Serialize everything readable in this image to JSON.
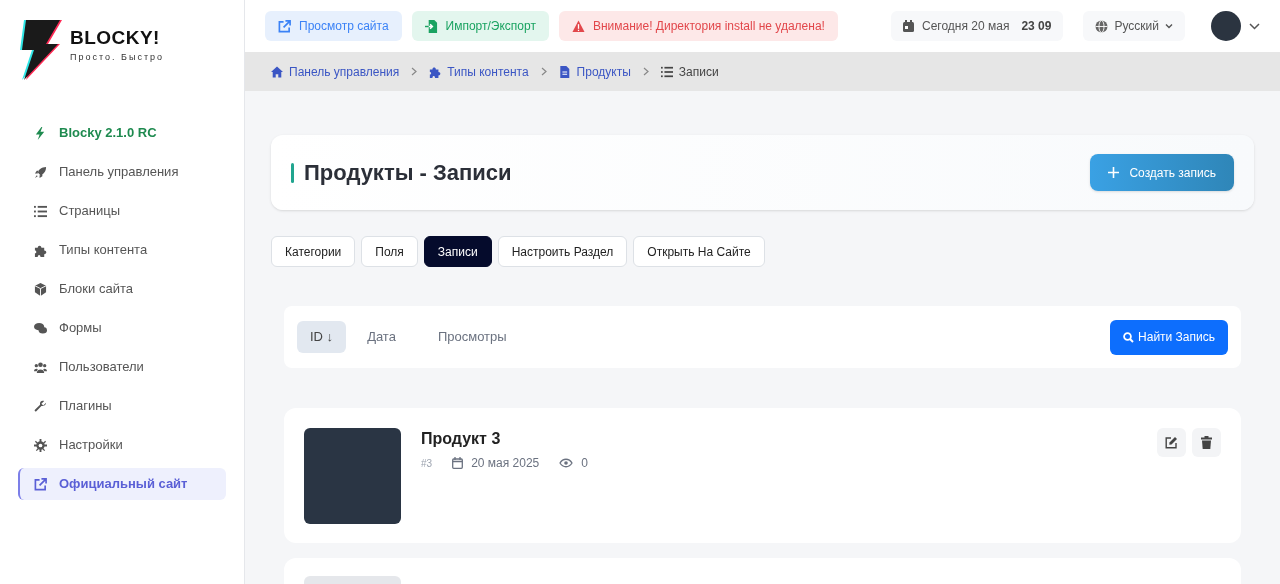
{
  "logo": {
    "title": "BLOCKY!",
    "tagline": "Просто. Быстро"
  },
  "sidebar": {
    "items": [
      {
        "label": "Blocky 2.1.0 RC",
        "kind": "version",
        "selected": false
      },
      {
        "label": "Панель управления",
        "kind": "link",
        "selected": false
      },
      {
        "label": "Страницы",
        "kind": "link",
        "selected": false
      },
      {
        "label": "Типы контента",
        "kind": "link",
        "selected": false
      },
      {
        "label": "Блоки сайта",
        "kind": "link",
        "selected": false
      },
      {
        "label": "Формы",
        "kind": "link",
        "selected": false
      },
      {
        "label": "Пользователи",
        "kind": "link",
        "selected": false
      },
      {
        "label": "Плагины",
        "kind": "link",
        "selected": false
      },
      {
        "label": "Настройки",
        "kind": "link",
        "selected": false
      },
      {
        "label": "Официальный сайт",
        "kind": "link",
        "selected": true
      }
    ]
  },
  "topbar": {
    "buttons": [
      {
        "label": "Просмотр сайта",
        "kind": "info"
      },
      {
        "label": "Импорт/Экспорт",
        "kind": "success"
      },
      {
        "label": "Внимание! Директория install не удалена!",
        "kind": "danger"
      }
    ],
    "date": "Сегодня 20 мая",
    "time": "23 09",
    "language": "Русский"
  },
  "breadcrumbs": [
    {
      "label": "Панель управления"
    },
    {
      "label": "Типы контента"
    },
    {
      "label": "Продукты"
    },
    {
      "label": "Записи"
    }
  ],
  "page": {
    "title": "Продукты - Записи",
    "create_button": "Создать запись"
  },
  "tabs": [
    {
      "label": "Категории",
      "selected": false
    },
    {
      "label": "Поля",
      "selected": false
    },
    {
      "label": "Записи",
      "selected": true
    },
    {
      "label": "Настроить Раздел",
      "selected": false
    },
    {
      "label": "Открыть На Сайте",
      "selected": false
    }
  ],
  "sort": {
    "options": [
      {
        "label": "ID ↓",
        "selected": true
      },
      {
        "label": "Дата",
        "selected": false
      },
      {
        "label": "Просмотры",
        "selected": false
      }
    ],
    "search_button": "Найти Запись"
  },
  "records": [
    {
      "title": "Продукт 3",
      "id": "#3",
      "date": "20 мая 2025",
      "views": "0"
    }
  ]
}
